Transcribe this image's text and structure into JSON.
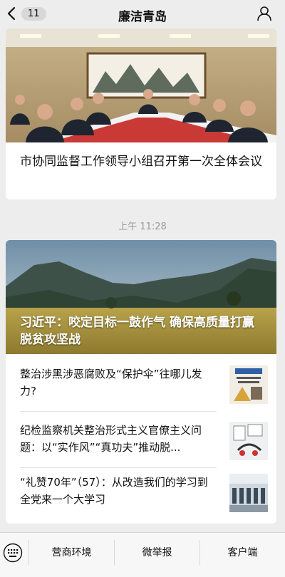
{
  "header": {
    "badge_count": "11",
    "title": "廉洁青岛"
  },
  "card1": {
    "headline": "市协同监督工作领导小组召开第一次全体会议"
  },
  "timestamp": "上午 11:28",
  "card2": {
    "hero_title": "习近平：咬定目标一鼓作气 确保高质量打赢脱贫攻坚战",
    "items": [
      {
        "title": "整治涉黑涉恶腐败及“保护伞”往哪儿发力?"
      },
      {
        "title": "纪检监察机关整治形式主义官僚主义问题：以“实作风”“真功夫”推动脱..."
      },
      {
        "title": "“礼赞70年”（57）：从改造我们的学习到全党来一个大学习"
      }
    ]
  },
  "bottom_menu": {
    "items": [
      "营商环境",
      "微举报",
      "客户端"
    ]
  },
  "icons": {
    "back": "chevron-left-icon",
    "profile": "person-icon",
    "keyboard": "keyboard-icon"
  }
}
